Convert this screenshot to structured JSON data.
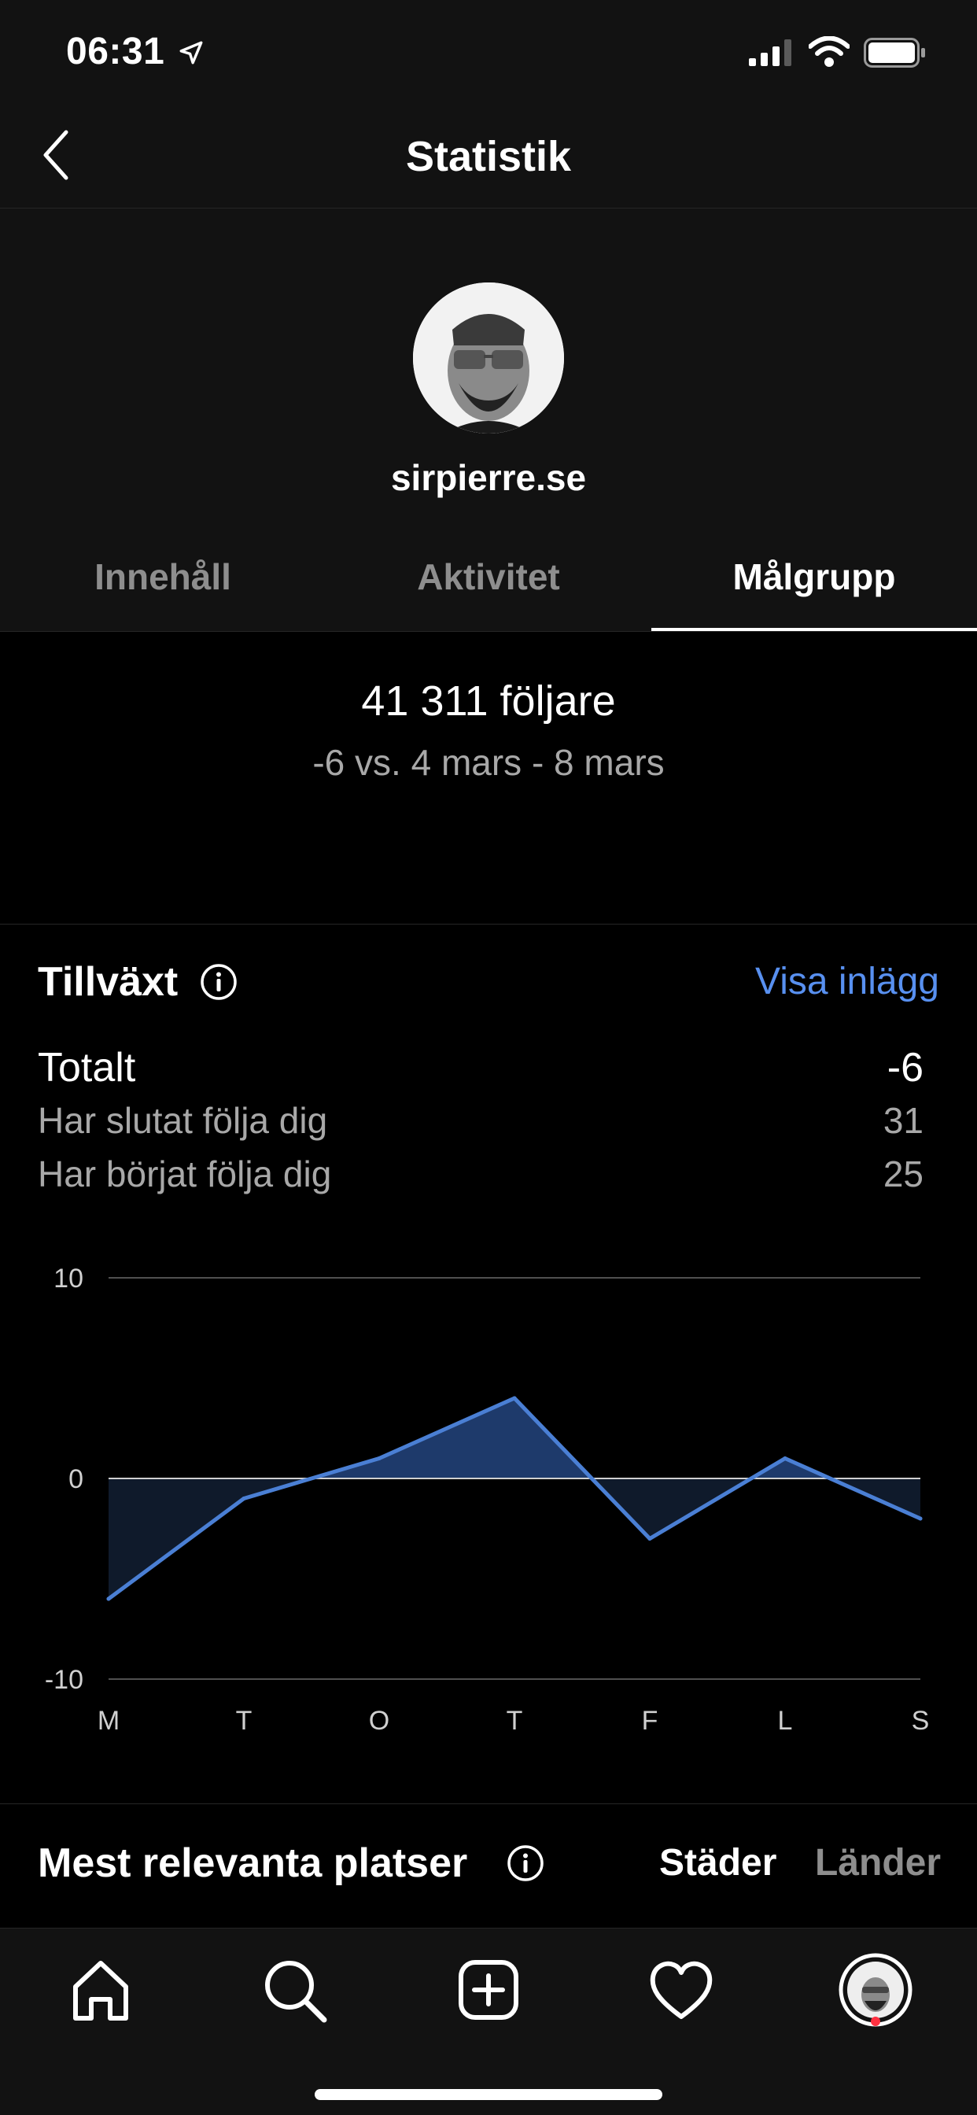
{
  "status_bar": {
    "time": "06:31"
  },
  "header": {
    "title": "Statistik"
  },
  "profile": {
    "username": "sirpierre.se"
  },
  "tabs": [
    {
      "label": "Innehåll",
      "active": false
    },
    {
      "label": "Aktivitet",
      "active": false
    },
    {
      "label": "Målgrupp",
      "active": true
    }
  ],
  "summary": {
    "followers": "41 311 följare",
    "delta": "-6 vs. 4 mars - 8 mars"
  },
  "growth": {
    "title": "Tillväxt",
    "link": "Visa inlägg",
    "rows": [
      {
        "label": "Totalt",
        "value": "-6"
      },
      {
        "label": "Har slutat följa dig",
        "value": "31"
      },
      {
        "label": "Har börjat följa dig",
        "value": "25"
      }
    ]
  },
  "chart_data": {
    "type": "area",
    "categories": [
      "M",
      "T",
      "O",
      "T",
      "F",
      "L",
      "S"
    ],
    "values": [
      -6,
      -1,
      1,
      4,
      -3,
      1,
      -2
    ],
    "ylim": [
      -10,
      10
    ],
    "yticks": [
      "10",
      "0",
      "-10"
    ],
    "grid": true,
    "colors": {
      "line": "#4a7fd4",
      "fill_positive": "#1e3a6b",
      "fill_negative": "#0f1a2b"
    }
  },
  "places": {
    "title": "Mest relevanta platser",
    "tabs": [
      {
        "label": "Städer",
        "active": true
      },
      {
        "label": "Länder",
        "active": false
      }
    ]
  },
  "bottom_nav": [
    "home-icon",
    "search-icon",
    "add-post-icon",
    "activity-heart-icon",
    "profile-avatar-icon"
  ]
}
